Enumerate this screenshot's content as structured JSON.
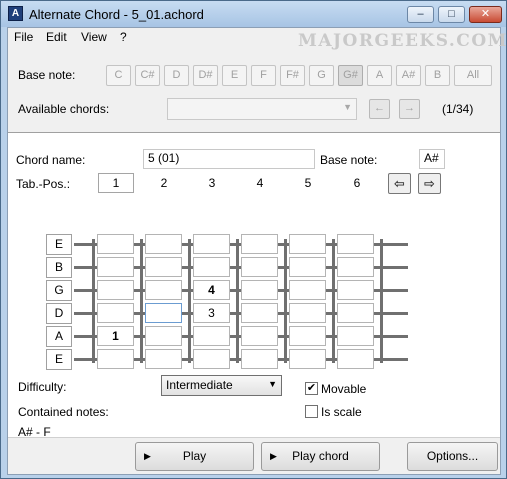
{
  "window": {
    "title": "Alternate Chord - 5_01.achord",
    "app_icon_glyph": "A",
    "minimize_glyph": "–",
    "maximize_glyph": "□",
    "close_glyph": "✕"
  },
  "watermark": "MAJORGEEKS.COM",
  "menu": [
    "File",
    "Edit",
    "View",
    "?"
  ],
  "base_note_bar": {
    "label": "Base note:",
    "notes": [
      "C",
      "C#",
      "D",
      "D#",
      "E",
      "F",
      "F#",
      "G",
      "G#",
      "A",
      "A#",
      "B",
      "All"
    ],
    "selected": "G#"
  },
  "available_chords": {
    "label": "Available chords:",
    "value": "",
    "prev_glyph": "←",
    "next_glyph": "→",
    "counter": "(1/34)"
  },
  "chord": {
    "name_label": "Chord name:",
    "name_value": "5 (01)",
    "base_note_label": "Base note:",
    "base_note_value": "A#",
    "tab_pos_label": "Tab.-Pos.:",
    "positions": [
      "1",
      "2",
      "3",
      "4",
      "5",
      "6"
    ],
    "prev_glyph": "⇦",
    "next_glyph": "⇨"
  },
  "fretboard": {
    "strings": [
      "E",
      "B",
      "G",
      "D",
      "A",
      "E"
    ],
    "cells": [
      [
        "",
        "",
        "",
        "",
        "",
        ""
      ],
      [
        "",
        "",
        "",
        "",
        "",
        ""
      ],
      [
        "",
        "",
        "4",
        "",
        "",
        ""
      ],
      [
        "",
        "",
        "3",
        "",
        "",
        ""
      ],
      [
        "1",
        "",
        "",
        "",
        "",
        ""
      ],
      [
        "",
        "",
        "",
        "",
        "",
        ""
      ]
    ]
  },
  "difficulty": {
    "label": "Difficulty:",
    "value": "Intermediate"
  },
  "movable": {
    "label": "Movable",
    "checked": true,
    "check_glyph": "✔"
  },
  "is_scale": {
    "label": "Is scale",
    "checked": false
  },
  "contained_notes": {
    "label": "Contained notes:",
    "value": "A# - F"
  },
  "footer": {
    "play_label": "Play",
    "play_chord_label": "Play chord",
    "options_label": "Options...",
    "play_glyph": "▶"
  }
}
